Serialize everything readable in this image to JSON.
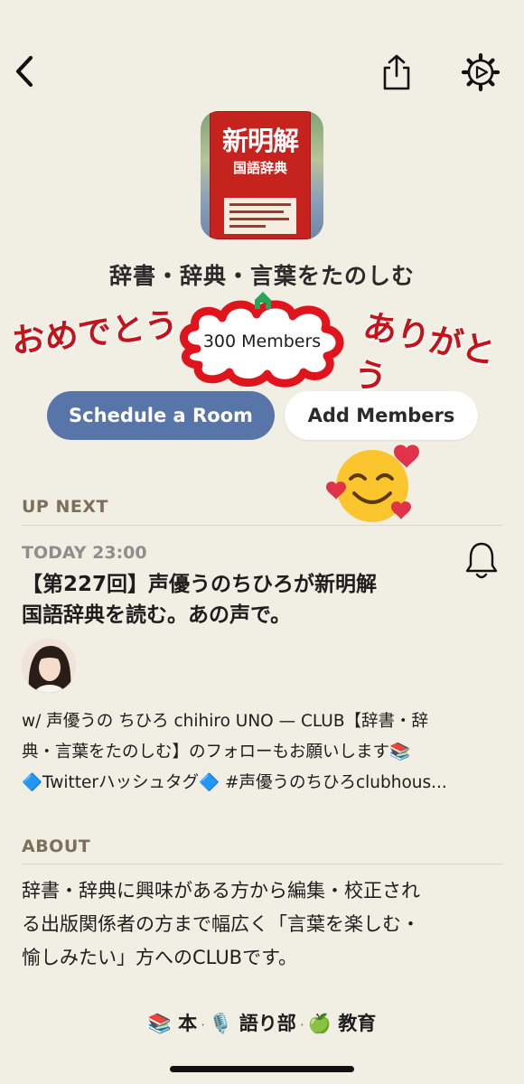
{
  "header": {
    "back_icon": "chevron-left-icon",
    "share_icon": "share-icon",
    "settings_icon": "gear-icon"
  },
  "club": {
    "cover_title": "新明解",
    "cover_subtitle": "国語辞典",
    "title": "辞書・辞典・言葉をたのしむ",
    "members_label": "300 Members",
    "decoration_left": "おめでとう",
    "decoration_right": "ありがとう"
  },
  "actions": {
    "schedule_label": "Schedule a Room",
    "add_members_label": "Add Members"
  },
  "up_next": {
    "heading": "UP NEXT",
    "time": "TODAY 23:00",
    "title_lines": [
      "【第227回】声優うのちひろが新明解",
      "国語辞典を読む。あの声で。"
    ],
    "description_lines": [
      "w/ 声優うの ちひろ chihiro UNO — CLUB【辞書・辞",
      "典・言葉をたのしむ】のフォローもお願いします📚",
      "🔷Twitterハッシュタグ🔷 #声優うのちひろclubhous..."
    ]
  },
  "about": {
    "heading": "ABOUT",
    "lines": [
      "辞書・辞典に興味がある方から編集・校正され",
      "る出版関係者の方まで幅広く「言葉を楽しむ・",
      "愉しみたい」方へのCLUBです。"
    ]
  },
  "tags": [
    {
      "emoji": "📚",
      "label": "本"
    },
    {
      "emoji": "🎙️",
      "label": "語り部"
    },
    {
      "emoji": "🍏",
      "label": "教育"
    }
  ],
  "colors": {
    "background": "#f1efe4",
    "primary_button": "#5775a8",
    "section_label": "#7d6f5c",
    "celebration_red": "#c4141b"
  }
}
